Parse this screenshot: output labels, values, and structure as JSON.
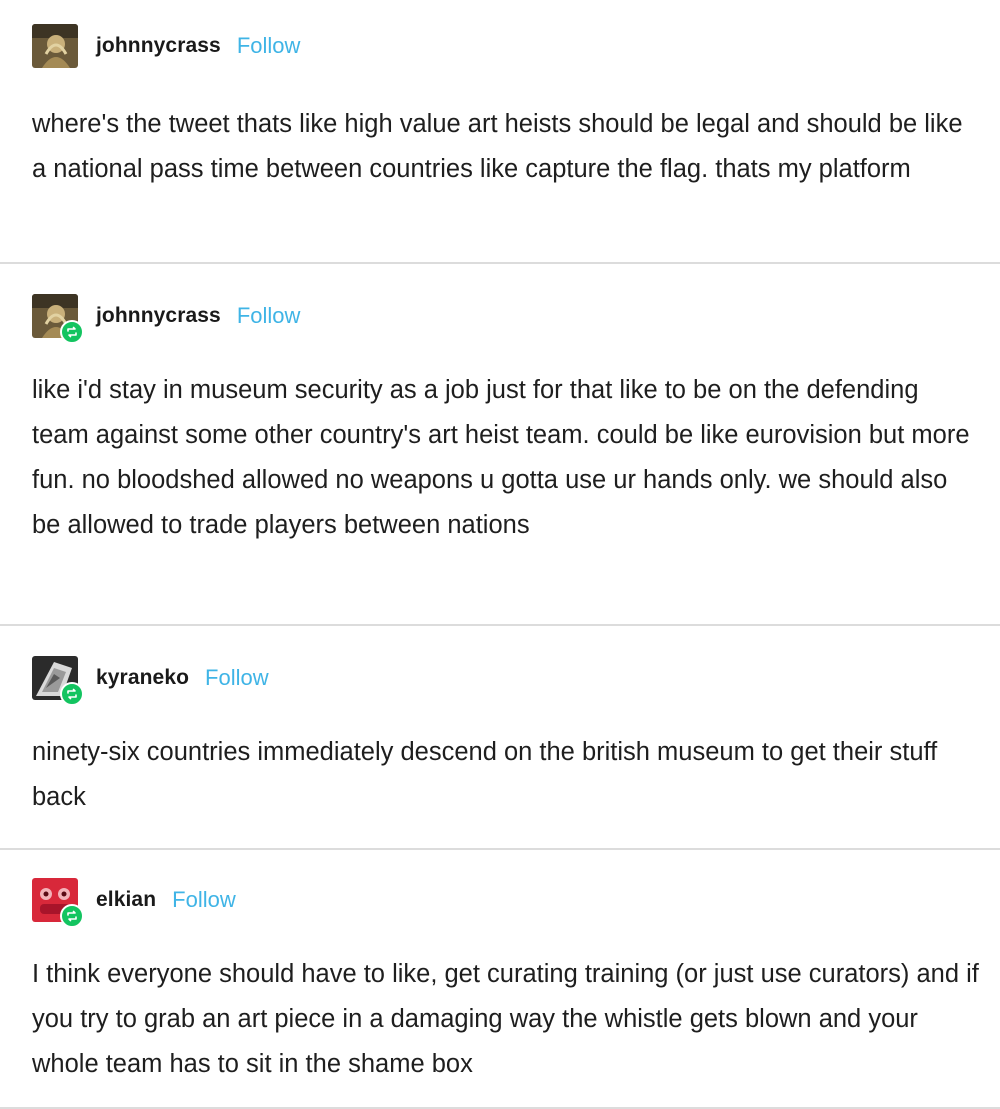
{
  "colors": {
    "follow": "#3fb4e6",
    "divider": "#dcdcdc",
    "reblog_badge": "#13c460"
  },
  "posts": [
    {
      "username": "johnnycrass",
      "follow_label": "Follow",
      "avatar_icon": "user-avatar-icon",
      "show_reblog_badge": false,
      "text": "where's the tweet thats like high value art heists should be legal and should be like a national pass time between countries like capture the flag. thats my platform"
    },
    {
      "username": "johnnycrass",
      "follow_label": "Follow",
      "avatar_icon": "user-avatar-icon",
      "show_reblog_badge": true,
      "text": "like i'd stay in museum security as a job just for that like to be on the defending team against some other country's art heist team. could be like eurovision but more fun. no bloodshed allowed no weapons u gotta use ur hands only. we should also be allowed to trade players between nations"
    },
    {
      "username": "kyraneko",
      "follow_label": "Follow",
      "avatar_icon": "user-avatar-icon",
      "show_reblog_badge": true,
      "text": "ninety-six countries immediately descend on the british museum to get their stuff back"
    },
    {
      "username": "elkian",
      "follow_label": "Follow",
      "avatar_icon": "user-avatar-icon",
      "show_reblog_badge": true,
      "text": "I think everyone should have to like, get curating training (or just use curators) and if you try to grab an art piece in a damaging way the whistle gets blown and your whole team has to sit in the shame box"
    }
  ]
}
